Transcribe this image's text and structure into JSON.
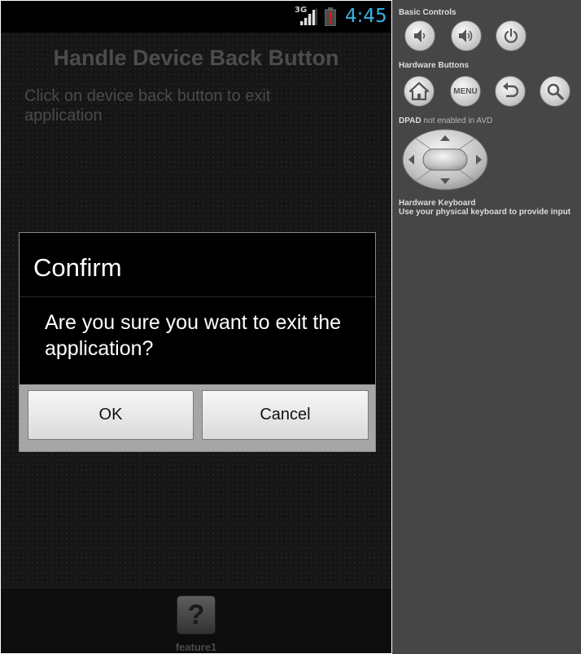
{
  "status_bar": {
    "network": "3G",
    "time": "4:45",
    "time_color": "#33b5e5"
  },
  "app": {
    "title": "Handle Device Back Button",
    "description": "Click on device back button to exit application"
  },
  "dialog": {
    "title": "Confirm",
    "message": "Are you sure you want to exit the application?",
    "ok_label": "OK",
    "cancel_label": "Cancel"
  },
  "bottom_bar": {
    "icon_glyph": "?",
    "label": "feature1"
  },
  "panel": {
    "basic_controls": "Basic Controls",
    "hardware_buttons": "Hardware Buttons",
    "dpad_label": "DPAD",
    "dpad_note": "not enabled in AVD",
    "keyboard_title": "Hardware Keyboard",
    "keyboard_note": "Use your physical keyboard to provide input",
    "menu_label": "MENU",
    "icons": {
      "volume_down": "volume-down-icon",
      "volume_up": "volume-up-icon",
      "power": "power-icon",
      "home": "home-icon",
      "back": "back-icon",
      "search": "search-icon"
    }
  }
}
